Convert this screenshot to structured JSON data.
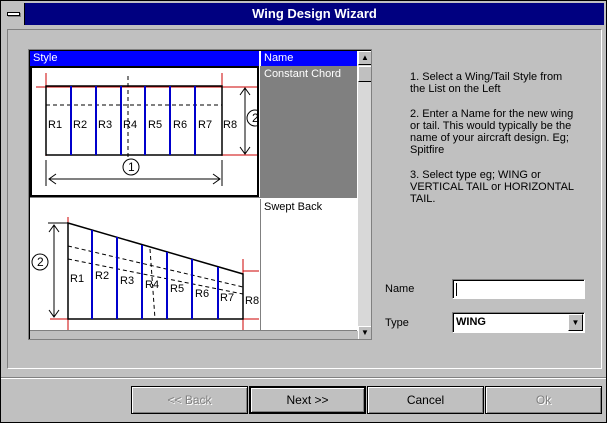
{
  "window": {
    "title": "Wing Design Wizard"
  },
  "list": {
    "columns": {
      "style": "Style",
      "name": "Name"
    },
    "rows": [
      {
        "name": "Constant Chord",
        "selected": true,
        "ribs": [
          "R1",
          "R2",
          "R3",
          "R4",
          "R5",
          "R6",
          "R7",
          "R8"
        ],
        "dims": [
          "1",
          "2"
        ]
      },
      {
        "name": "Swept Back",
        "selected": false,
        "ribs": [
          "R1",
          "R2",
          "R3",
          "R4",
          "R5",
          "R6",
          "R7",
          "R8"
        ],
        "dims": [
          "2"
        ]
      }
    ]
  },
  "instructions": {
    "step1": "1. Select a Wing/Tail Style from the List on the Left",
    "step2": "2. Enter a Name for the new wing or tail. This would typically be the name of your aircraft design. Eg; Spitfire",
    "step3": "3. Select type eg; WING or VERTICAL TAIL or HORIZONTAL TAIL."
  },
  "form": {
    "name_label": "Name",
    "name_value": "",
    "type_label": "Type",
    "type_value": "WING"
  },
  "buttons": {
    "back": "<< Back",
    "next": "Next >>",
    "cancel": "Cancel",
    "ok": "Ok"
  },
  "colors": {
    "title_bar": "#000080",
    "selection_header": "#0000ff",
    "spar_blue": "#0000cc",
    "dimension_red": "#cc0000",
    "face": "#c0c0c0"
  }
}
